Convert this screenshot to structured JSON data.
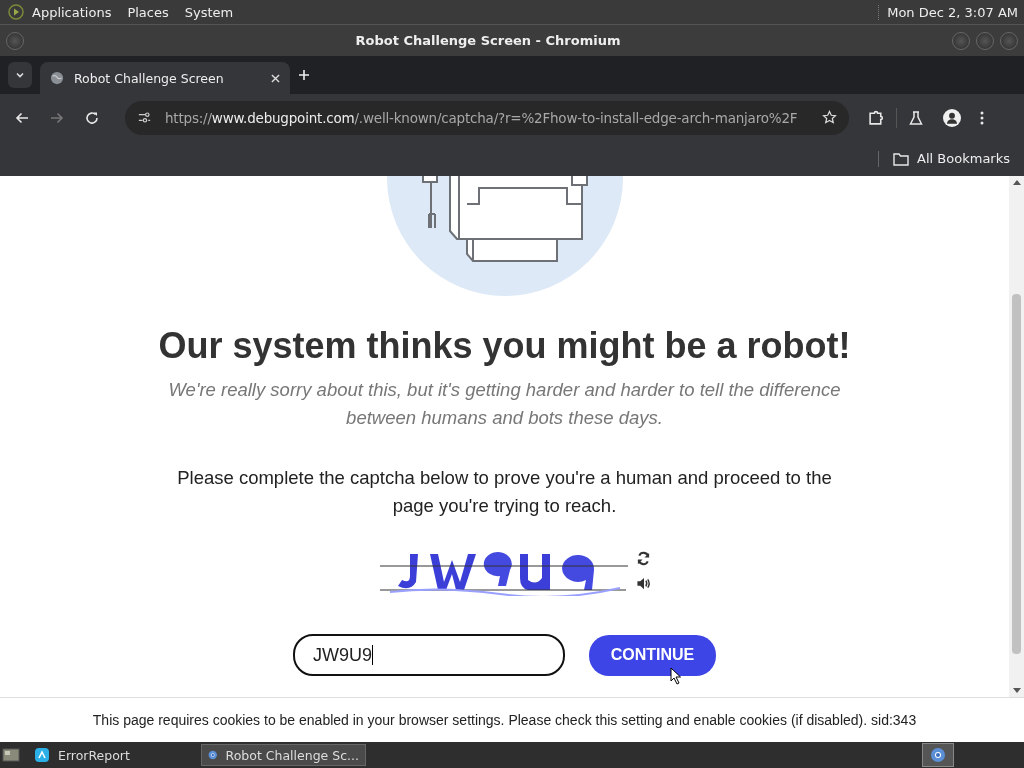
{
  "top_panel": {
    "menus": [
      "Applications",
      "Places",
      "System"
    ],
    "clock": "Mon Dec 2, 3:07 AM"
  },
  "window": {
    "title": "Robot Challenge Screen - Chromium"
  },
  "tabs": [
    {
      "label": "Robot Challenge Screen",
      "selected": true
    }
  ],
  "address_bar": {
    "scheme": "https://",
    "host": "www.debugpoint.com",
    "path": "/.well-known/captcha/?r=%2Fhow-to-install-edge-arch-manjaro%2F"
  },
  "bookmarks": [
    {
      "label": "All Bookmarks"
    }
  ],
  "page": {
    "heading": "Our system thinks you might be a robot!",
    "subtitle": "We're really sorry about this, but it's getting harder and harder to tell the difference between humans and bots these days.",
    "instruction": "Please complete the captcha below to prove you're a human and proceed to the page you're trying to reach.",
    "answer": {
      "value": "JW9U9"
    },
    "button": "CONTINUE"
  },
  "cookie_notice": "This page requires cookies to be enabled in your browser settings. Please check this setting and enable cookies (if disabled). sid:343",
  "taskbar": [
    {
      "label": "ErrorReport",
      "selected": false
    },
    {
      "label": "Robot Challenge Sc...",
      "selected": true
    }
  ]
}
